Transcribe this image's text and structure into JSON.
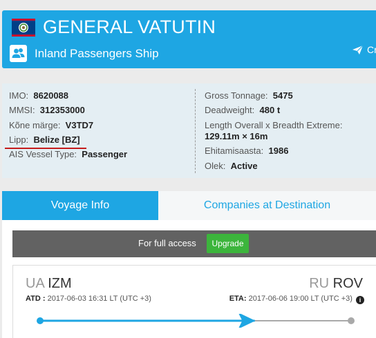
{
  "header": {
    "ship_name": "GENERAL VATUTIN",
    "ship_type": "Inland Passengers Ship",
    "action_label": "Cre",
    "color": "#1ea6e3"
  },
  "details": {
    "left": [
      {
        "label": "IMO:",
        "value": "8620088"
      },
      {
        "label": "MMSI:",
        "value": "312353000"
      },
      {
        "label": "Kõne märge:",
        "value": "V3TD7"
      },
      {
        "label": "Lipp:",
        "value": "Belize [BZ]"
      },
      {
        "label": "AIS Vessel Type:",
        "value": "Passenger"
      }
    ],
    "right": [
      {
        "label": "Gross Tonnage:",
        "value": "5475"
      },
      {
        "label": "Deadweight:",
        "value": "480 t"
      },
      {
        "label": "Length Overall x Breadth Extreme:",
        "value": "129.11m × 16m"
      },
      {
        "label": "Ehitamisaasta:",
        "value": "1986"
      },
      {
        "label": "Olek:",
        "value": "Active"
      }
    ]
  },
  "tabs": [
    {
      "label": "Voyage Info"
    },
    {
      "label": "Companies at Destination"
    }
  ],
  "access": {
    "text": "For full access",
    "button": "Upgrade"
  },
  "voyage": {
    "from_cc": "UA",
    "from_port": "IZM",
    "to_cc": "RU",
    "to_port": "ROV",
    "atd_label": "ATD :",
    "atd_value": "2017-06-03 16:31 LT (UTC +3)",
    "eta_label": "ETA:",
    "eta_value": "2017-06-06 19:00 LT (UTC +3)",
    "progress": 0.69
  }
}
